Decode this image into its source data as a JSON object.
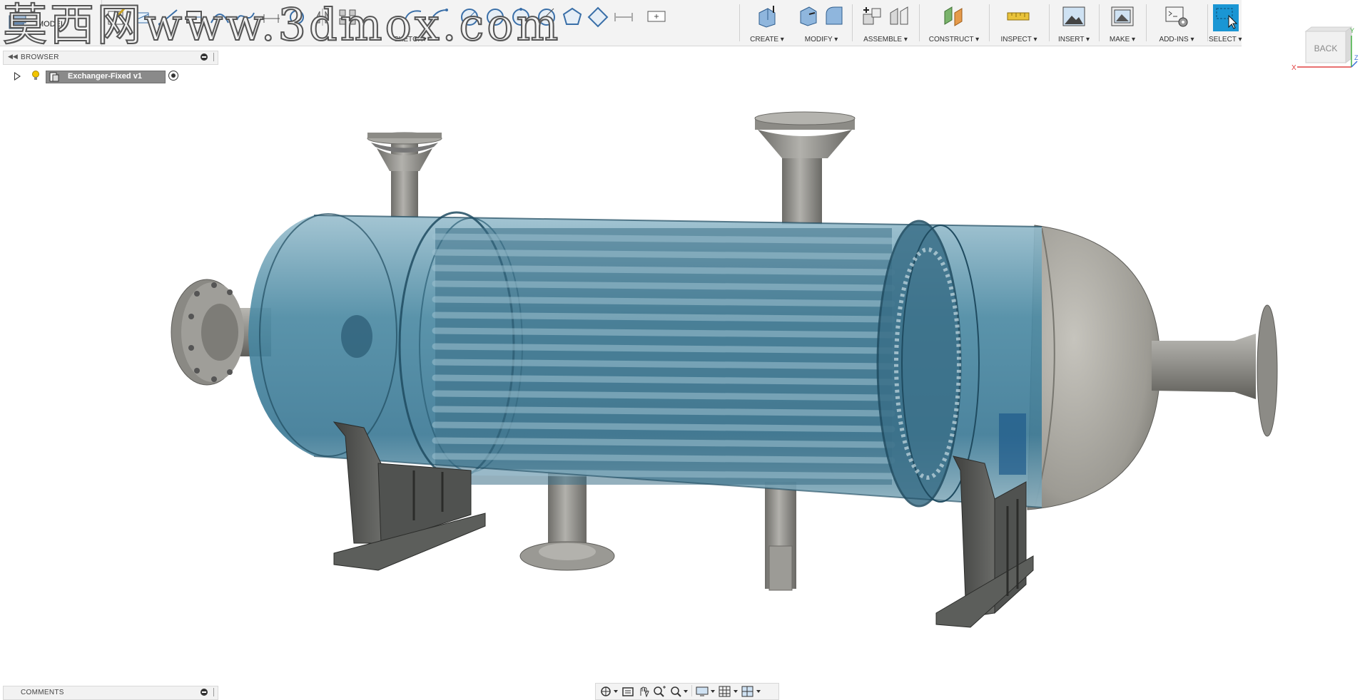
{
  "workspace": {
    "label": "MODEL"
  },
  "toolbar": {
    "sketch_label": "SKETCH",
    "groups": [
      {
        "key": "create",
        "label": "CREATE"
      },
      {
        "key": "modify",
        "label": "MODIFY"
      },
      {
        "key": "assemble",
        "label": "ASSEMBLE"
      },
      {
        "key": "construct",
        "label": "CONSTRUCT"
      },
      {
        "key": "inspect",
        "label": "INSPECT"
      },
      {
        "key": "insert",
        "label": "INSERT"
      },
      {
        "key": "make",
        "label": "MAKE"
      },
      {
        "key": "addins",
        "label": "ADD-INS"
      },
      {
        "key": "select",
        "label": "SELECT"
      }
    ],
    "dropdown_marker": "▾"
  },
  "browser": {
    "title": "BROWSER",
    "root_item": {
      "label": "Exchanger-Fixed v1"
    }
  },
  "comments": {
    "title": "COMMENTS"
  },
  "viewcube": {
    "face_label": "BACK",
    "axis_x": "X",
    "axis_y": "Y",
    "axis_z": "Z"
  },
  "watermark": {
    "text": "莫西网www.3dmox.com"
  },
  "colors": {
    "toolbar_bg": "#f3f3f3",
    "select_accent": "#1a96d4",
    "shell_glass": "#3d7a96",
    "metal": "#8e8d88",
    "support": "#4b4c4a"
  }
}
